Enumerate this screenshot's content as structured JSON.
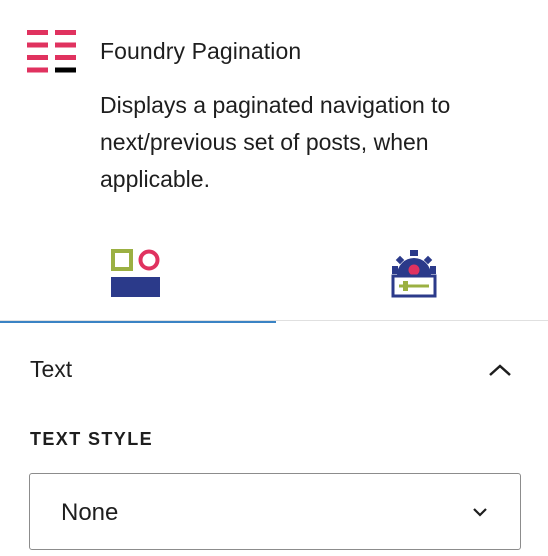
{
  "block": {
    "icon": "grid-lines-icon",
    "title": "Foundry Pagination",
    "description": "Displays a paginated navigation to next/previous set of posts, when applicable."
  },
  "tabs": [
    {
      "name": "styles",
      "icon": "shapes-icon",
      "active": true
    },
    {
      "name": "settings",
      "icon": "gear-settings-icon",
      "active": false
    }
  ],
  "panel": {
    "title": "Text",
    "expanded": true,
    "fields": {
      "text_style": {
        "label": "TEXT STYLE",
        "value": "None"
      }
    }
  },
  "colors": {
    "accent_pink": "#e0325f",
    "accent_olive": "#9bb042",
    "accent_navy": "#2b3a8a",
    "tab_indicator": "#3a83c4"
  }
}
